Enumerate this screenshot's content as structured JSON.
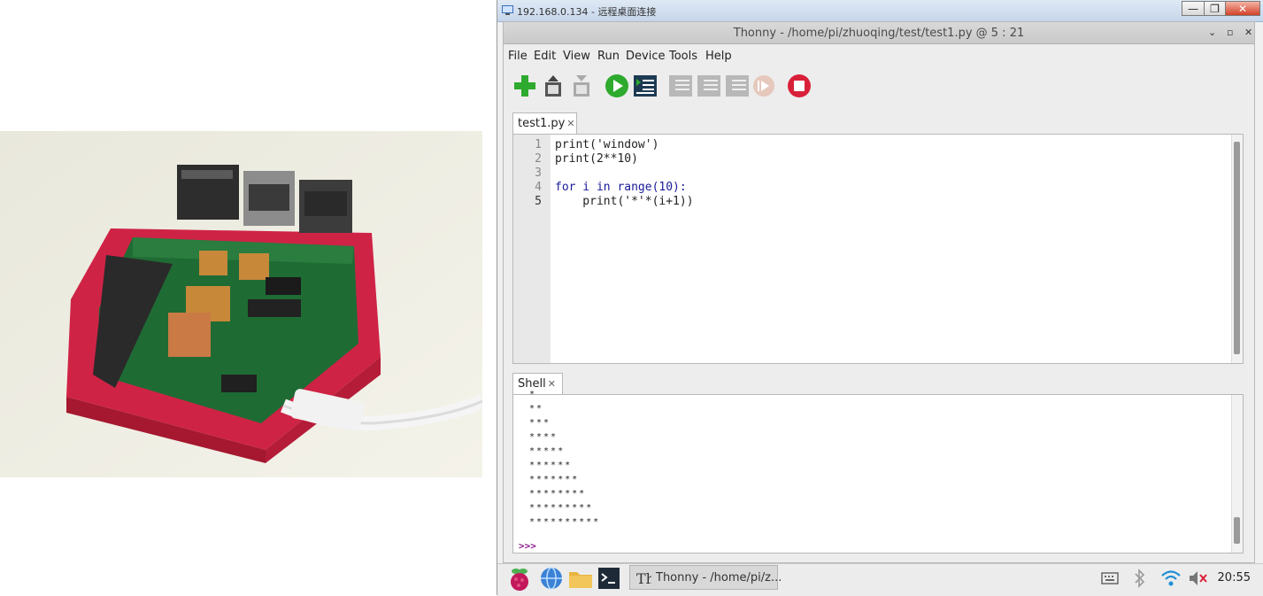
{
  "remote_desktop": {
    "window_title": "192.168.0.134 - 远程桌面连接",
    "controls": {
      "minimize": "—",
      "restore": "❐",
      "close": "✕"
    }
  },
  "thonny": {
    "window_title": "Thonny  -  /home/pi/zhuoqing/test/test1.py  @  5 : 21",
    "controls": {
      "minimize": "⌄",
      "maximize": "▫",
      "close": "✕"
    },
    "menu": [
      "File",
      "Edit",
      "View",
      "Run",
      "Device",
      "Tools",
      "Help"
    ],
    "toolbar_icons": [
      "new-file-icon",
      "open-file-icon",
      "save-file-icon",
      "run-icon",
      "debug-icon",
      "step-over-icon",
      "step-into-icon",
      "step-out-icon",
      "resume-icon",
      "stop-icon"
    ],
    "editor_tab": {
      "label": "test1.py",
      "close": "✕"
    },
    "code_lines": [
      "print('window')",
      "print(2**10)",
      "",
      "for i in range(10):",
      "    print('*'*(i+1))"
    ],
    "line_numbers": [
      "1",
      "2",
      "3",
      "4",
      "5"
    ],
    "shell_tab": {
      "label": "Shell",
      "close": "✕"
    },
    "shell_output": [
      "*",
      "**",
      "***",
      "****",
      "*****",
      "******",
      "*******",
      "********",
      "*********",
      "**********"
    ],
    "shell_prompt": ">>>"
  },
  "taskbar": {
    "task_label": "Thonny  -  /home/pi/z...",
    "clock": "20:55",
    "icons": [
      "raspberry-menu-icon",
      "web-browser-icon",
      "file-manager-icon",
      "terminal-icon",
      "keyboard-icon",
      "bluetooth-icon",
      "wifi-icon",
      "volume-muted-icon"
    ]
  },
  "colors": {
    "run_green": "#2eaa2e",
    "stop_red": "#d9203a",
    "case_red": "#d22a48"
  }
}
